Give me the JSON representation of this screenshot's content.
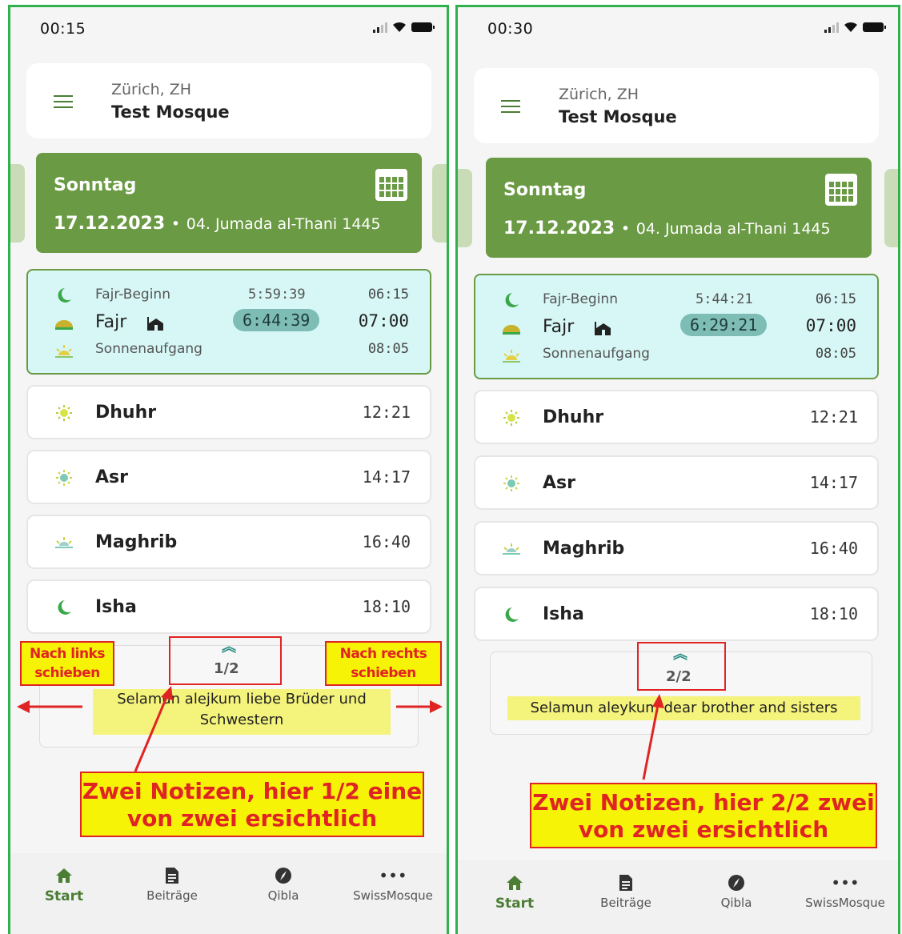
{
  "screens": [
    {
      "status_time": "00:15",
      "header": {
        "city": "Zürich, ZH",
        "mosque": "Test Mosque"
      },
      "day": {
        "weekday": "Sonntag",
        "date": "17.12.2023",
        "hijri": "04. Jumada al-Thani 1445",
        "separator": "•"
      },
      "fajr_card": {
        "fajr_begin": {
          "name": "Fajr-Beginn",
          "remaining": "5:59:39",
          "time": "06:15"
        },
        "fajr": {
          "name": "Fajr",
          "remaining": "6:44:39",
          "time": "07:00"
        },
        "sunrise": {
          "name": "Sonnenaufgang",
          "time": "08:05"
        }
      },
      "prayers": [
        {
          "name": "Dhuhr",
          "time": "12:21",
          "icon": "sun-icon"
        },
        {
          "name": "Asr",
          "time": "14:17",
          "icon": "sun-afternoon-icon"
        },
        {
          "name": "Maghrib",
          "time": "16:40",
          "icon": "sunset-icon"
        },
        {
          "name": "Isha",
          "time": "18:10",
          "icon": "crescent-moon-icon"
        }
      ],
      "note": {
        "page": "1/2",
        "text": "Selamun alejkum liebe Brüder und Schwestern"
      },
      "annotations": {
        "left_swipe": "Nach links schieben",
        "right_swipe": "Nach rechts schieben",
        "callout": "Zwei Notizen, hier 1/2 eine von zwei ersichtlich"
      }
    },
    {
      "status_time": "00:30",
      "header": {
        "city": "Zürich, ZH",
        "mosque": "Test Mosque"
      },
      "day": {
        "weekday": "Sonntag",
        "date": "17.12.2023",
        "hijri": "04. Jumada al-Thani 1445",
        "separator": "•"
      },
      "fajr_card": {
        "fajr_begin": {
          "name": "Fajr-Beginn",
          "remaining": "5:44:21",
          "time": "06:15"
        },
        "fajr": {
          "name": "Fajr",
          "remaining": "6:29:21",
          "time": "07:00"
        },
        "sunrise": {
          "name": "Sonnenaufgang",
          "time": "08:05"
        }
      },
      "prayers": [
        {
          "name": "Dhuhr",
          "time": "12:21",
          "icon": "sun-icon"
        },
        {
          "name": "Asr",
          "time": "14:17",
          "icon": "sun-afternoon-icon"
        },
        {
          "name": "Maghrib",
          "time": "16:40",
          "icon": "sunset-icon"
        },
        {
          "name": "Isha",
          "time": "18:10",
          "icon": "crescent-moon-icon"
        }
      ],
      "note": {
        "page": "2/2",
        "text": "Selamun aleykum dear brother and sisters"
      },
      "annotations": {
        "callout": "Zwei Notizen, hier 2/2 zwei von zwei ersichtlich"
      }
    }
  ],
  "nav": {
    "start": "Start",
    "posts": "Beiträge",
    "qibla": "Qibla",
    "more": "SwissMosque"
  },
  "colors": {
    "brand_green": "#6a9a43",
    "fajr_bg": "#d6f7f5",
    "highlight": "#7dbdb6",
    "annotation_red": "#e02424",
    "annotation_yellow": "#f6f306",
    "frame_green": "#2fb24b"
  }
}
